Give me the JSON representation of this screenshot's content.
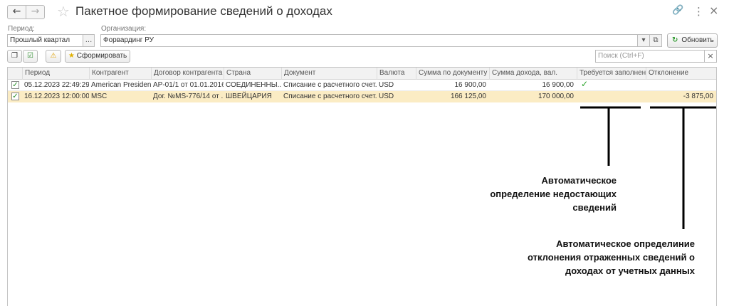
{
  "window": {
    "title": "Пакетное формирование сведений о доходах",
    "back_symbol": "←",
    "forward_symbol": "→",
    "favorite_symbol": "☆",
    "link_symbol": "🔗",
    "menu_symbol": "⋮",
    "close_symbol": "×"
  },
  "filters": {
    "period_label": "Период:",
    "period_value": "Прошлый квартал",
    "period_select_symbol": "...",
    "org_label": "Организация:",
    "org_value": "Форвардинг РУ",
    "org_dropdown_symbol": "▾",
    "org_open_symbol": "⧉",
    "refresh_label": "Обновить",
    "refresh_symbol": "↻"
  },
  "toolbar": {
    "copy_symbol": "❐",
    "check_symbol": "☑",
    "warning_symbol": "⚠",
    "form_symbol": "★",
    "form_label": "Сформировать",
    "search_placeholder": "Поиск (Ctrl+F)",
    "search_clear_symbol": "×"
  },
  "table": {
    "columns": [
      "Период",
      "Контрагент",
      "Договор контрагента",
      "Страна",
      "Документ",
      "Валюта",
      "Сумма по документу",
      "Сумма дохода, вал.",
      "Требуется заполнен...",
      "Отклонение"
    ],
    "rows": [
      {
        "checked": "✓",
        "period": "05.12.2023 22:49:29",
        "counterparty": "American President...",
        "contract": "AP-01/1 от 01.01.2016",
        "country": "СОЕДИНЕННЫ...",
        "document": "Списание с расчетного счет...",
        "currency": "USD",
        "doc_amount": "16 900,00",
        "income_amount": "16 900,00",
        "requires_fill": "✓",
        "deviation": ""
      },
      {
        "checked": "✓",
        "period": "16.12.2023 12:00:00",
        "counterparty": "MSC",
        "contract": "Дог. №MS-776/14 от ...",
        "country": "ШВЕЙЦАРИЯ",
        "document": "Списание с расчетного счет...",
        "currency": "USD",
        "doc_amount": "166 125,00",
        "income_amount": "170 000,00",
        "requires_fill": "",
        "deviation": "-3 875,00"
      }
    ]
  },
  "annotations": {
    "missing_info": [
      "Автоматическое",
      "определение недостающих",
      "сведений"
    ],
    "deviation_info": [
      "Автоматическое определиние",
      "отклонения отраженных сведений о",
      "доходах от учетных данных"
    ]
  }
}
